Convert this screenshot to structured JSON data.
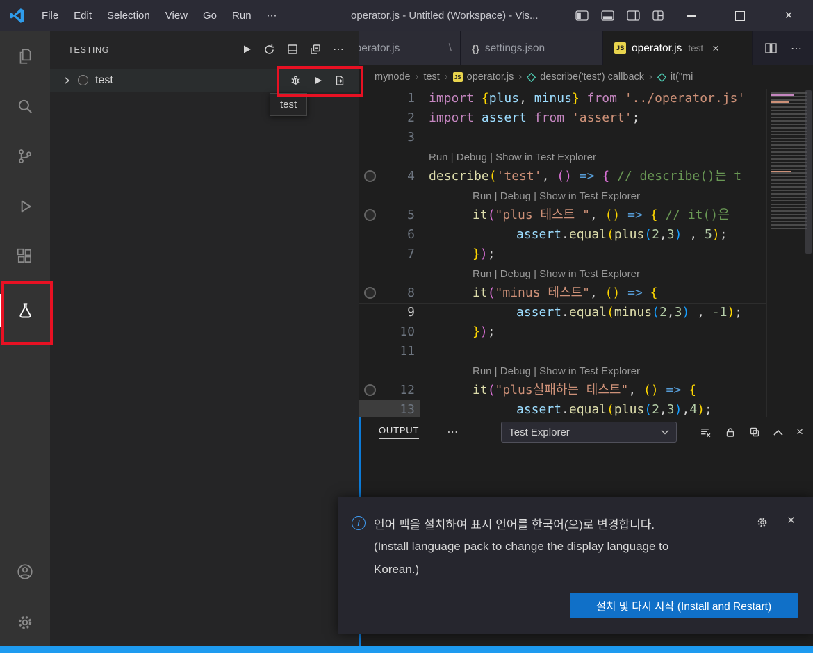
{
  "titlebar": {
    "menus": [
      "File",
      "Edit",
      "Selection",
      "View",
      "Go",
      "Run"
    ],
    "more": "⋯",
    "title": "operator.js - Untitled (Workspace) - Vis...",
    "close_glyph": "×"
  },
  "sidebar": {
    "title": "TESTING",
    "item_label": "test",
    "tooltip": "test",
    "more": "⋯"
  },
  "tabs": [
    {
      "label": "operator.js",
      "mark": "\\"
    },
    {
      "label": "settings.json",
      "icon": "{}"
    },
    {
      "label": "operator.js",
      "icon": "JS",
      "detail": "test",
      "close": "×"
    }
  ],
  "editor_actions": {
    "more": "⋯"
  },
  "breadcrumbs": {
    "sep": "›",
    "items": [
      {
        "label": "mynode"
      },
      {
        "label": "test"
      },
      {
        "label": "operator.js",
        "icon": "JS"
      },
      {
        "label": "describe('test') callback"
      },
      {
        "label": "it(\"mi"
      }
    ]
  },
  "editor": {
    "codelens": "Run | Debug | Show in Test Explorer",
    "lines": [
      {
        "n": "1",
        "ind": 0,
        "tok": [
          [
            "kw",
            "import "
          ],
          [
            "b1",
            "{"
          ],
          [
            "vr",
            "plus"
          ],
          [
            "tx",
            ", "
          ],
          [
            "vr",
            "minus"
          ],
          [
            "b1",
            "}"
          ],
          [
            "tx",
            " "
          ],
          [
            "kw",
            "from"
          ],
          [
            "tx",
            " "
          ],
          [
            "st",
            "'../operator.js'"
          ]
        ]
      },
      {
        "n": "2",
        "ind": 0,
        "tok": [
          [
            "kw",
            "import "
          ],
          [
            "vr",
            "assert"
          ],
          [
            "tx",
            " "
          ],
          [
            "kw",
            "from"
          ],
          [
            "tx",
            " "
          ],
          [
            "st",
            "'assert'"
          ],
          [
            "tx",
            ";"
          ]
        ]
      },
      {
        "n": "3",
        "ind": 0,
        "tok": []
      },
      {
        "cl": true,
        "ind": 0
      },
      {
        "n": "4",
        "ind": 0,
        "dec": true,
        "tok": [
          [
            "fn",
            "describe"
          ],
          [
            "b1",
            "("
          ],
          [
            "st",
            "'test'"
          ],
          [
            "tx",
            ", "
          ],
          [
            "b2",
            "()"
          ],
          [
            "tx",
            " "
          ],
          [
            "ar",
            "=>"
          ],
          [
            "tx",
            " "
          ],
          [
            "b2",
            "{"
          ],
          [
            "cm",
            " // describe()는 t"
          ]
        ]
      },
      {
        "cl": true,
        "ind": 1
      },
      {
        "n": "5",
        "ind": 1,
        "dec": true,
        "tok": [
          [
            "fn",
            "it"
          ],
          [
            "b2",
            "("
          ],
          [
            "st",
            "\"plus 테스트 \""
          ],
          [
            "tx",
            ", "
          ],
          [
            "b1",
            "()"
          ],
          [
            "tx",
            " "
          ],
          [
            "ar",
            "=>"
          ],
          [
            "tx",
            " "
          ],
          [
            "b1",
            "{"
          ],
          [
            "cm",
            " // it()은 "
          ]
        ]
      },
      {
        "n": "6",
        "ind": 2,
        "tok": [
          [
            "vr",
            "assert"
          ],
          [
            "tx",
            "."
          ],
          [
            "fn",
            "equal"
          ],
          [
            "b1",
            "("
          ],
          [
            "fn",
            "plus"
          ],
          [
            "b3",
            "("
          ],
          [
            "nm",
            "2"
          ],
          [
            "tx",
            ","
          ],
          [
            "nm",
            "3"
          ],
          [
            "b3",
            ")"
          ],
          [
            "tx",
            " , "
          ],
          [
            "nm",
            "5"
          ],
          [
            "b1",
            ")"
          ],
          [
            "tx",
            ";"
          ]
        ]
      },
      {
        "n": "7",
        "ind": 1,
        "tok": [
          [
            "b1",
            "}"
          ],
          [
            "b2",
            ")"
          ],
          [
            "tx",
            ";"
          ]
        ]
      },
      {
        "cl": true,
        "ind": 1
      },
      {
        "n": "8",
        "ind": 1,
        "dec": true,
        "tok": [
          [
            "fn",
            "it"
          ],
          [
            "b2",
            "("
          ],
          [
            "st",
            "\"minus 테스트\""
          ],
          [
            "tx",
            ", "
          ],
          [
            "b1",
            "()"
          ],
          [
            "tx",
            " "
          ],
          [
            "ar",
            "=>"
          ],
          [
            "tx",
            " "
          ],
          [
            "b1",
            "{"
          ]
        ]
      },
      {
        "n": "9",
        "ind": 2,
        "active": true,
        "tok": [
          [
            "vr",
            "assert"
          ],
          [
            "tx",
            "."
          ],
          [
            "fn",
            "equal"
          ],
          [
            "b1",
            "("
          ],
          [
            "fn",
            "minus"
          ],
          [
            "b3",
            "("
          ],
          [
            "nm",
            "2"
          ],
          [
            "tx",
            ","
          ],
          [
            "nm",
            "3"
          ],
          [
            "b3",
            ")"
          ],
          [
            "tx",
            " , "
          ],
          [
            "nm",
            "-1"
          ],
          [
            "b1",
            ")"
          ],
          [
            "tx",
            ";"
          ]
        ]
      },
      {
        "n": "10",
        "ind": 1,
        "tok": [
          [
            "b1",
            "}"
          ],
          [
            "b2",
            ")"
          ],
          [
            "tx",
            ";"
          ]
        ]
      },
      {
        "n": "11",
        "ind": 0,
        "tok": []
      },
      {
        "cl": true,
        "ind": 1
      },
      {
        "n": "12",
        "ind": 1,
        "dec": true,
        "tok": [
          [
            "fn",
            "it"
          ],
          [
            "b2",
            "("
          ],
          [
            "st",
            "\"plus실패하는 테스트\""
          ],
          [
            "tx",
            ", "
          ],
          [
            "b1",
            "()"
          ],
          [
            "tx",
            " "
          ],
          [
            "ar",
            "=>"
          ],
          [
            "tx",
            " "
          ],
          [
            "b1",
            "{"
          ]
        ]
      },
      {
        "n": "13",
        "ind": 2,
        "ghl": true,
        "tok": [
          [
            "vr",
            "assert"
          ],
          [
            "tx",
            "."
          ],
          [
            "fn",
            "equal"
          ],
          [
            "b1",
            "("
          ],
          [
            "fn",
            "plus"
          ],
          [
            "b3",
            "("
          ],
          [
            "nm",
            "2"
          ],
          [
            "tx",
            ","
          ],
          [
            "nm",
            "3"
          ],
          [
            "b3",
            ")"
          ],
          [
            "tx",
            ","
          ],
          [
            "nm",
            "4"
          ],
          [
            "b1",
            ")"
          ],
          [
            "tx",
            ";"
          ]
        ]
      }
    ]
  },
  "panel": {
    "tab": "OUTPUT",
    "more": "⋯",
    "dropdown_value": "Test Explorer",
    "close": "×"
  },
  "notification": {
    "message_ko": "언어 팩을 설치하여 표시 언어를 한국어(으)로 변경합니다.",
    "message_en_line1": "(Install language pack to change the display language to",
    "message_en_line2": "Korean.)",
    "button_label": "설치 및 다시 시작 (Install and Restart)",
    "info_glyph": "i",
    "close": "×"
  },
  "colors": {
    "annotation_red": "#e81123",
    "status_bar_blue": "#1e9bf0",
    "button_blue": "#1070c8",
    "panel_sash_blue": "#0c7bd8",
    "editor_bg": "#1e1e1e",
    "activity_bar_bg": "#333333",
    "sidebar_bg": "#252526"
  }
}
